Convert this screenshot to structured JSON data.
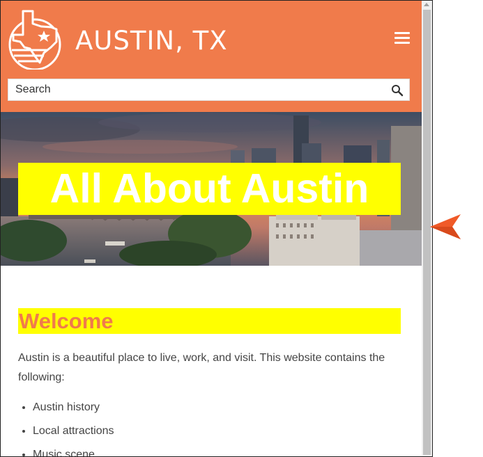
{
  "header": {
    "brand": "AUSTIN, TX",
    "logo_icon": "texas-star-logo-icon",
    "menu_icon": "hamburger-menu-icon"
  },
  "search": {
    "placeholder": "Search",
    "icon": "search-icon"
  },
  "hero": {
    "title": "All About Austin"
  },
  "main": {
    "heading": "Welcome",
    "intro": "Austin is a beautiful place to live, work, and visit. This website contains the following:",
    "list": [
      "Austin history",
      "Local attractions",
      "Music scene"
    ]
  },
  "colors": {
    "brand": "#f07b4b",
    "highlight": "#ffff00",
    "pointer": "#f05a28"
  },
  "overlay": {
    "pointer_icon": "arrow-pointer-icon"
  }
}
